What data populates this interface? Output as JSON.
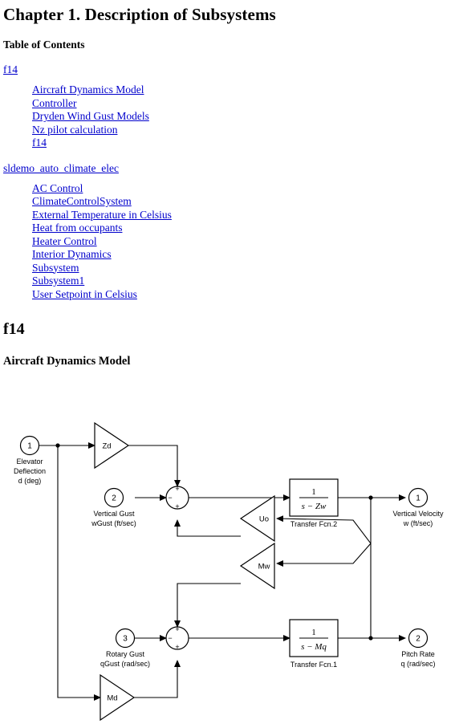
{
  "chapter": {
    "title": "Chapter 1. Description of Subsystems"
  },
  "toc": {
    "heading": "Table of Contents",
    "groups": [
      {
        "model": "f14",
        "items": [
          "Aircraft Dynamics Model",
          "Controller",
          "Dryden Wind Gust Models",
          "Nz pilot calculation",
          "f14"
        ]
      },
      {
        "model": "sldemo_auto_climate_elec",
        "items": [
          "AC Control",
          "ClimateControlSystem",
          "External Temperature in Celsius",
          "Heat from occupants",
          "Heater Control",
          "Interior Dynamics",
          "Subsystem",
          "Subsystem1",
          "User Setpoint in Celsius"
        ]
      }
    ]
  },
  "sections": {
    "model_title": "f14",
    "block_title": "Aircraft Dynamics Model"
  },
  "diagram": {
    "inports": [
      {
        "num": "1",
        "line1": "Elevator",
        "line2": "Deflection",
        "line3": "d (deg)"
      },
      {
        "num": "2",
        "line1": "Vertical Gust",
        "line2": "wGust (ft/sec)",
        "line3": ""
      },
      {
        "num": "3",
        "line1": "Rotary Gust",
        "line2": "qGust (rad/sec)",
        "line3": ""
      }
    ],
    "outports": [
      {
        "num": "1",
        "line1": "Vertical Velocity",
        "line2": "w (ft/sec)"
      },
      {
        "num": "2",
        "line1": "Pitch Rate",
        "line2": "q (rad/sec)"
      }
    ],
    "gains": [
      {
        "label": "Zd"
      },
      {
        "label": "Uo"
      },
      {
        "label": "Mw"
      },
      {
        "label": "Md"
      }
    ],
    "transfer_functions": [
      {
        "numerator": "1",
        "denominator": "s − Zw",
        "caption": "Transfer Fcn.2"
      },
      {
        "numerator": "1",
        "denominator": "s − Mq",
        "caption": "Transfer Fcn.1"
      }
    ],
    "sum_blocks": [
      {
        "top": "+",
        "left": "−",
        "bottom": "+"
      },
      {
        "top": "+",
        "left": "−",
        "bottom": "+"
      }
    ]
  },
  "colors": {
    "link": "#0000cc",
    "text": "#000000",
    "background": "#ffffff"
  }
}
